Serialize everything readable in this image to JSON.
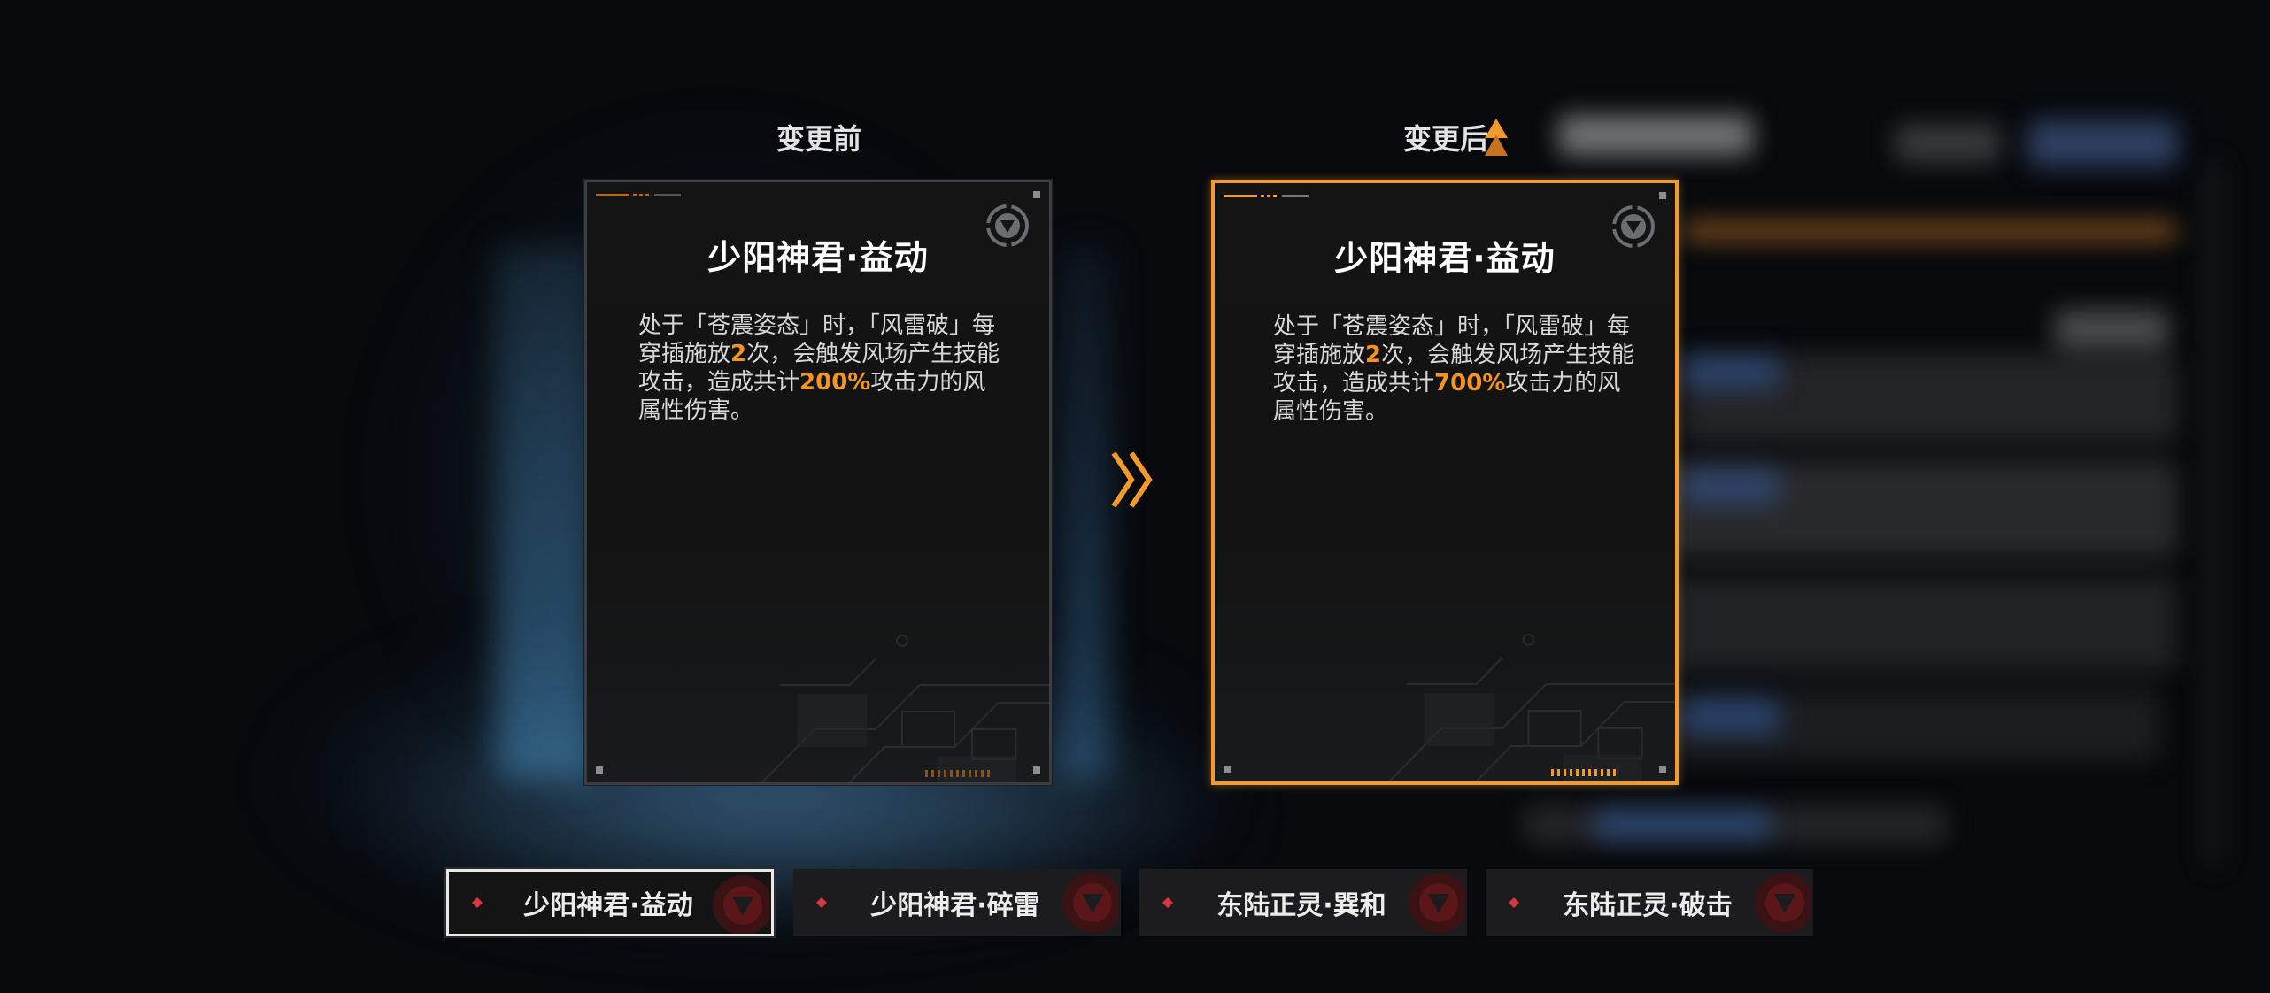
{
  "headings": {
    "before": "变更前",
    "after": "变更后"
  },
  "cards": {
    "before": {
      "title": "少阳神君·益动",
      "desc_part1": "处于「苍震姿态」时，「风雷破」每穿插施放",
      "hits": "2",
      "desc_part2": "次，会触发风场产生技能攻击，造成共计",
      "damage": "200%",
      "desc_part3": "攻击力的风属性伤害。"
    },
    "after": {
      "title": "少阳神君·益动",
      "desc_part1": "处于「苍震姿态」时，「风雷破」每穿插施放",
      "hits": "2",
      "desc_part2": "次，会触发风场产生技能攻击，造成共计",
      "damage": "700%",
      "desc_part3": "攻击力的风属性伤害。"
    }
  },
  "tabs": [
    {
      "label": "少阳神君·益动",
      "active": true
    },
    {
      "label": "少阳神君·碎雷",
      "active": false
    },
    {
      "label": "东陆正灵·巽和",
      "active": false
    },
    {
      "label": "东陆正灵·破击",
      "active": false
    }
  ],
  "colors": {
    "accent": "#f5941f",
    "frame_active": "#f39a2c",
    "tab_diamond": "#d9363e",
    "emblem_red": "#5a1618"
  },
  "icons": {
    "card_emblem": "shield-triangle-emblem-icon",
    "change_marker": "triangle-marker-icon",
    "arrow": "double-chevron-right-icon",
    "tab_marker": "diamond-icon"
  }
}
